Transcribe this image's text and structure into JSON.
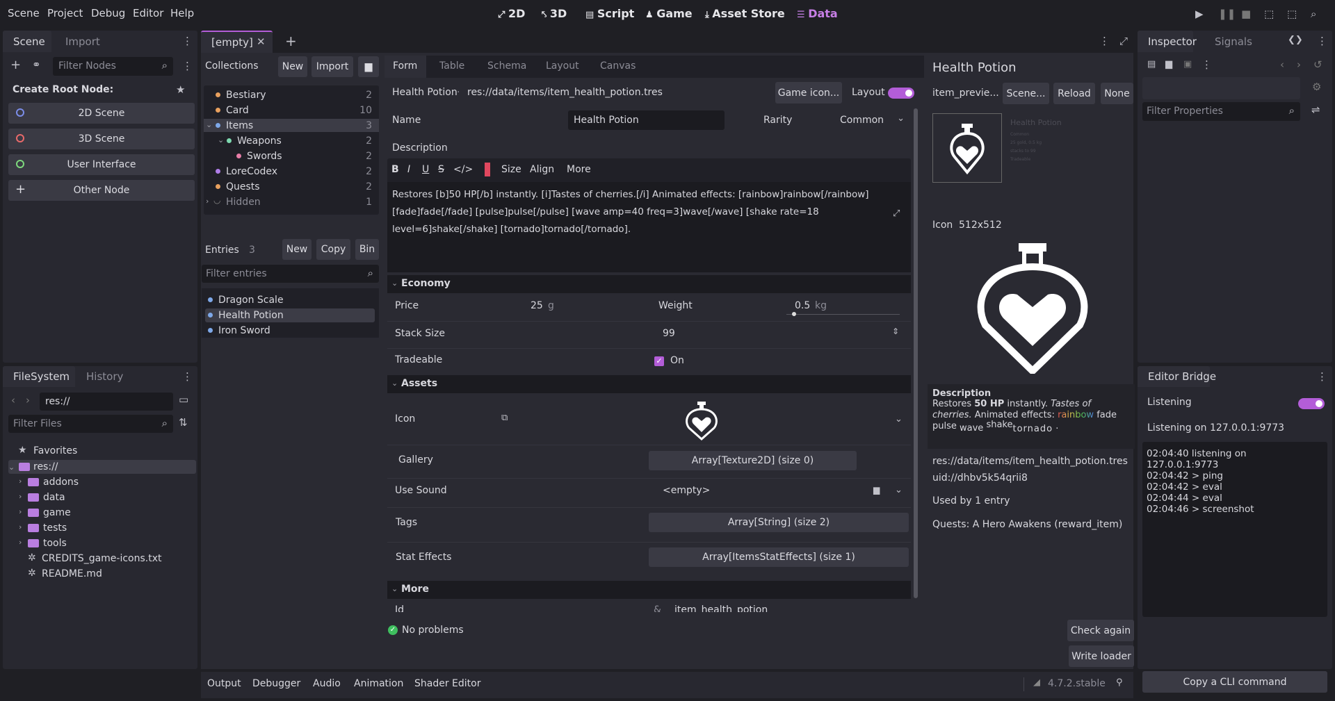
{
  "menu": [
    "Scene",
    "Project",
    "Debug",
    "Editor",
    "Help"
  ],
  "toolbar": {
    "d2": "2D",
    "d3": "3D",
    "script": "Script",
    "game": "Game",
    "asset": "Asset Store",
    "data": "Data"
  },
  "left_top": {
    "tab_scene": "Scene",
    "tab_import": "Import",
    "filter_placeholder": "Filter Nodes",
    "create_root": "Create Root Node:",
    "nodes": [
      "2D Scene",
      "3D Scene",
      "User Interface",
      "Other Node"
    ]
  },
  "filesystem": {
    "tab_fs": "FileSystem",
    "tab_history": "History",
    "path": "res://",
    "filter_placeholder": "Filter Files",
    "favorites": "Favorites",
    "root": "res://",
    "folders": [
      "addons",
      "data",
      "game",
      "tests",
      "tools"
    ],
    "files": [
      "CREDITS_game-icons.txt",
      "README.md"
    ]
  },
  "doc_tab": {
    "label": "[empty]"
  },
  "collections": {
    "title": "Collections",
    "new": "New",
    "import": "Import",
    "items": [
      {
        "label": "Bestiary",
        "count": "2"
      },
      {
        "label": "Card",
        "count": "10"
      },
      {
        "label": "Items",
        "count": "3"
      },
      {
        "label": "Weapons",
        "count": "2"
      },
      {
        "label": "Swords",
        "count": "2"
      },
      {
        "label": "LoreCodex",
        "count": "2"
      },
      {
        "label": "Quests",
        "count": "2"
      },
      {
        "label": "Hidden",
        "count": "1"
      }
    ]
  },
  "entries": {
    "title": "Entries",
    "count": "3",
    "new": "New",
    "copy": "Copy",
    "bin": "Bin",
    "filter_placeholder": "Filter entries",
    "items": [
      "Dragon Scale",
      "Health Potion",
      "Iron Sword"
    ]
  },
  "form_tabs": [
    "Form",
    "Table",
    "Schema",
    "Layout",
    "Canvas"
  ],
  "form": {
    "entry_name": "Health Potion",
    "sep": "·",
    "path": "res://data/items/item_health_potion.tres",
    "game_icon": "Game icon...",
    "layout": "Layout",
    "name_label": "Name",
    "name_value": "Health Potion",
    "rarity_label": "Rarity",
    "rarity_value": "Common",
    "desc_label": "Description",
    "fmt": {
      "b": "B",
      "i": "I",
      "u": "U",
      "s": "S",
      "code": "</>",
      "size": "Size",
      "align": "Align",
      "more": "More"
    },
    "desc_line1": "Restores [b]50 HP[/b] instantly. [i]Tastes of cherries.[/i] Animated effects: [rainbow]rainbow[/rainbow]",
    "desc_line2": "[fade]fade[/fade] [pulse]pulse[/pulse] [wave amp=40 freq=3]wave[/wave] [shake rate=18",
    "desc_line3": "level=6]shake[/shake] [tornado]tornado[/tornado].",
    "economy": "Economy",
    "price_label": "Price",
    "price_value": "25",
    "price_unit": "g",
    "weight_label": "Weight",
    "weight_value": "0.5",
    "weight_unit": "kg",
    "weight_fraction": 0.05,
    "stack_label": "Stack Size",
    "stack_value": "99",
    "tradeable_label": "Tradeable",
    "tradeable_value": "On",
    "assets": "Assets",
    "icon_label": "Icon",
    "gallery_label": "Gallery",
    "gallery_value": "Array[Texture2D] (size 0)",
    "sound_label": "Use Sound",
    "sound_value": "<empty>",
    "tags_label": "Tags",
    "tags_value": "Array[String] (size 2)",
    "stat_label": "Stat Effects",
    "stat_value": "Array[ItemsStatEffects] (size 1)",
    "more": "More",
    "id_label": "Id",
    "id_value": "item_health_potion",
    "status": "No problems",
    "check_again": "Check again",
    "write_loader": "Write loader"
  },
  "preview": {
    "title": "Health Potion",
    "item_preview": "item_previe...",
    "scene": "Scene...",
    "reload": "Reload",
    "none": "None",
    "thumb_title": "Health Potion",
    "thumb_lines": [
      "Common",
      "25 gold, 0.5 kg",
      "stacks to 99",
      "Tradeable"
    ],
    "icon_label": "Icon",
    "icon_size": "512x512",
    "desc_head": "Description",
    "desc_pre": "Restores ",
    "desc_bold": "50 HP",
    "desc_mid": " instantly. ",
    "desc_ital": "Tastes of cherries.",
    "desc_post": " Animated effects: ",
    "rainbow": "rainbow",
    "fade": "fade",
    "pulse": "pulse",
    "wave": "wave",
    "shake": "shake",
    "tornado": "tornado",
    "desc_end": ".",
    "res_path": "res://data/items/item_health_potion.tres",
    "uid": "uid://dhbv5k54qrii8",
    "used_by": "Used by 1 entry",
    "quest": "Quests: A Hero Awakens  (reward_item)"
  },
  "inspector": {
    "tab_inspector": "Inspector",
    "tab_signals": "Signals",
    "filter_placeholder": "Filter Properties"
  },
  "bridge": {
    "title": "Editor Bridge",
    "listening": "Listening",
    "listening_on": "Listening on 127.0.0.1:9773",
    "log": [
      "02:04:40  listening on",
      "127.0.0.1:9773",
      "02:04:42  > ping",
      "02:04:42  > eval",
      "02:04:44  > eval",
      "02:04:46  > screenshot"
    ],
    "copy_cli": "Copy a CLI command"
  },
  "bottom": {
    "tabs": [
      "Output",
      "Debugger",
      "Audio",
      "Animation",
      "Shader Editor"
    ],
    "version": "4.7.2.stable"
  },
  "colors": {
    "accent": "#b35dd8",
    "bg": "#1f1f24",
    "panel": "#282830"
  }
}
